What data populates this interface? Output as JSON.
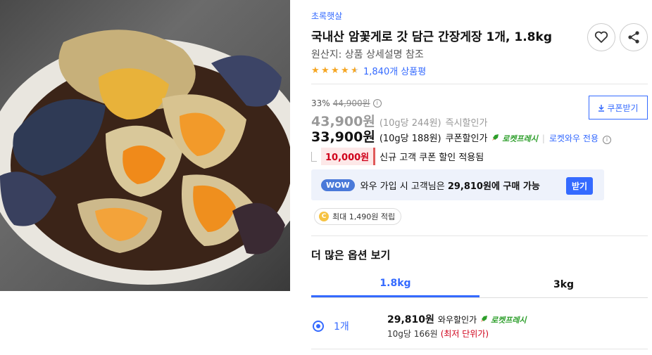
{
  "product": {
    "brand": "초록햇살",
    "title": "국내산 암꽃게로 갓 담근 간장게장 1개, 1.8kg",
    "origin": "원산지: 상품 상세설명 참조",
    "rating": 4.5,
    "review_count": "1,840개 상품평",
    "image_alt": "seasoned crab"
  },
  "pricing": {
    "discount_rate": "33%",
    "original_price": "44,900원",
    "instant_price": "43,900원",
    "instant_unit": "(10g당 244원)",
    "instant_label": "즉시할인가",
    "coupon_price": "33,900원",
    "coupon_unit": "(10g당 188원)",
    "coupon_label": "쿠폰할인가",
    "rocket_label": "로켓프레시",
    "separator": "|",
    "wow_only": "로켓와우 전용",
    "coupon_button": "쿠폰받기"
  },
  "new_customer": {
    "amount": "10,000원",
    "text": "신규 고객 쿠폰 할인 적용됨"
  },
  "wow": {
    "pill": "WOW",
    "text_prefix": "와우 가입 시 고객님은",
    "text_price": "29,810원에 구매 가능",
    "button": "받기"
  },
  "points": {
    "coin": "C",
    "text": "최대 1,490원 적립"
  },
  "options": {
    "title": "더 많은 옵션 보기",
    "tabs": [
      {
        "label": "1.8kg",
        "active": true
      },
      {
        "label": "3kg",
        "active": false
      }
    ],
    "item": {
      "qty": "1개",
      "price": "29,810원",
      "price_label": "와우할인가",
      "rocket_label": "로켓프레시",
      "unit_price": "10g당 166원",
      "lowest": "(최저 단위가)"
    }
  },
  "colors": {
    "accent": "#346aff",
    "rocket_green": "#2c9e2a",
    "sale_red": "#d0021b",
    "star": "#f5a623"
  }
}
